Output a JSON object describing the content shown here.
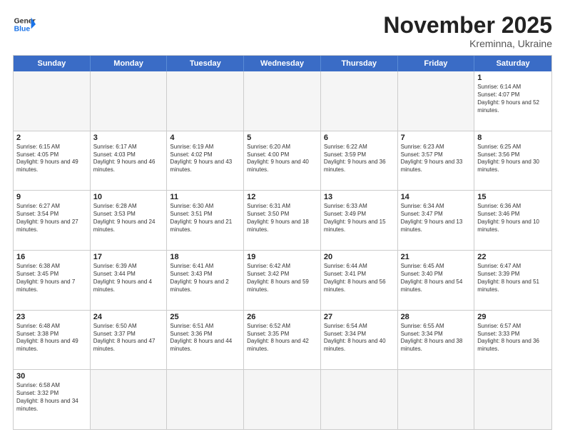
{
  "header": {
    "logo_general": "General",
    "logo_blue": "Blue",
    "month_title": "November 2025",
    "location": "Kreminna, Ukraine"
  },
  "day_headers": [
    "Sunday",
    "Monday",
    "Tuesday",
    "Wednesday",
    "Thursday",
    "Friday",
    "Saturday"
  ],
  "rows": [
    [
      {
        "date": "",
        "info": "",
        "empty": true
      },
      {
        "date": "",
        "info": "",
        "empty": true
      },
      {
        "date": "",
        "info": "",
        "empty": true
      },
      {
        "date": "",
        "info": "",
        "empty": true
      },
      {
        "date": "",
        "info": "",
        "empty": true
      },
      {
        "date": "",
        "info": "",
        "empty": true
      },
      {
        "date": "1",
        "info": "Sunrise: 6:14 AM\nSunset: 4:07 PM\nDaylight: 9 hours and 52 minutes.",
        "empty": false
      }
    ],
    [
      {
        "date": "2",
        "info": "Sunrise: 6:15 AM\nSunset: 4:05 PM\nDaylight: 9 hours and 49 minutes.",
        "empty": false
      },
      {
        "date": "3",
        "info": "Sunrise: 6:17 AM\nSunset: 4:03 PM\nDaylight: 9 hours and 46 minutes.",
        "empty": false
      },
      {
        "date": "4",
        "info": "Sunrise: 6:19 AM\nSunset: 4:02 PM\nDaylight: 9 hours and 43 minutes.",
        "empty": false
      },
      {
        "date": "5",
        "info": "Sunrise: 6:20 AM\nSunset: 4:00 PM\nDaylight: 9 hours and 40 minutes.",
        "empty": false
      },
      {
        "date": "6",
        "info": "Sunrise: 6:22 AM\nSunset: 3:59 PM\nDaylight: 9 hours and 36 minutes.",
        "empty": false
      },
      {
        "date": "7",
        "info": "Sunrise: 6:23 AM\nSunset: 3:57 PM\nDaylight: 9 hours and 33 minutes.",
        "empty": false
      },
      {
        "date": "8",
        "info": "Sunrise: 6:25 AM\nSunset: 3:56 PM\nDaylight: 9 hours and 30 minutes.",
        "empty": false
      }
    ],
    [
      {
        "date": "9",
        "info": "Sunrise: 6:27 AM\nSunset: 3:54 PM\nDaylight: 9 hours and 27 minutes.",
        "empty": false
      },
      {
        "date": "10",
        "info": "Sunrise: 6:28 AM\nSunset: 3:53 PM\nDaylight: 9 hours and 24 minutes.",
        "empty": false
      },
      {
        "date": "11",
        "info": "Sunrise: 6:30 AM\nSunset: 3:51 PM\nDaylight: 9 hours and 21 minutes.",
        "empty": false
      },
      {
        "date": "12",
        "info": "Sunrise: 6:31 AM\nSunset: 3:50 PM\nDaylight: 9 hours and 18 minutes.",
        "empty": false
      },
      {
        "date": "13",
        "info": "Sunrise: 6:33 AM\nSunset: 3:49 PM\nDaylight: 9 hours and 15 minutes.",
        "empty": false
      },
      {
        "date": "14",
        "info": "Sunrise: 6:34 AM\nSunset: 3:47 PM\nDaylight: 9 hours and 13 minutes.",
        "empty": false
      },
      {
        "date": "15",
        "info": "Sunrise: 6:36 AM\nSunset: 3:46 PM\nDaylight: 9 hours and 10 minutes.",
        "empty": false
      }
    ],
    [
      {
        "date": "16",
        "info": "Sunrise: 6:38 AM\nSunset: 3:45 PM\nDaylight: 9 hours and 7 minutes.",
        "empty": false
      },
      {
        "date": "17",
        "info": "Sunrise: 6:39 AM\nSunset: 3:44 PM\nDaylight: 9 hours and 4 minutes.",
        "empty": false
      },
      {
        "date": "18",
        "info": "Sunrise: 6:41 AM\nSunset: 3:43 PM\nDaylight: 9 hours and 2 minutes.",
        "empty": false
      },
      {
        "date": "19",
        "info": "Sunrise: 6:42 AM\nSunset: 3:42 PM\nDaylight: 8 hours and 59 minutes.",
        "empty": false
      },
      {
        "date": "20",
        "info": "Sunrise: 6:44 AM\nSunset: 3:41 PM\nDaylight: 8 hours and 56 minutes.",
        "empty": false
      },
      {
        "date": "21",
        "info": "Sunrise: 6:45 AM\nSunset: 3:40 PM\nDaylight: 8 hours and 54 minutes.",
        "empty": false
      },
      {
        "date": "22",
        "info": "Sunrise: 6:47 AM\nSunset: 3:39 PM\nDaylight: 8 hours and 51 minutes.",
        "empty": false
      }
    ],
    [
      {
        "date": "23",
        "info": "Sunrise: 6:48 AM\nSunset: 3:38 PM\nDaylight: 8 hours and 49 minutes.",
        "empty": false
      },
      {
        "date": "24",
        "info": "Sunrise: 6:50 AM\nSunset: 3:37 PM\nDaylight: 8 hours and 47 minutes.",
        "empty": false
      },
      {
        "date": "25",
        "info": "Sunrise: 6:51 AM\nSunset: 3:36 PM\nDaylight: 8 hours and 44 minutes.",
        "empty": false
      },
      {
        "date": "26",
        "info": "Sunrise: 6:52 AM\nSunset: 3:35 PM\nDaylight: 8 hours and 42 minutes.",
        "empty": false
      },
      {
        "date": "27",
        "info": "Sunrise: 6:54 AM\nSunset: 3:34 PM\nDaylight: 8 hours and 40 minutes.",
        "empty": false
      },
      {
        "date": "28",
        "info": "Sunrise: 6:55 AM\nSunset: 3:34 PM\nDaylight: 8 hours and 38 minutes.",
        "empty": false
      },
      {
        "date": "29",
        "info": "Sunrise: 6:57 AM\nSunset: 3:33 PM\nDaylight: 8 hours and 36 minutes.",
        "empty": false
      }
    ],
    [
      {
        "date": "30",
        "info": "Sunrise: 6:58 AM\nSunset: 3:32 PM\nDaylight: 8 hours and 34 minutes.",
        "empty": false
      },
      {
        "date": "",
        "info": "",
        "empty": true
      },
      {
        "date": "",
        "info": "",
        "empty": true
      },
      {
        "date": "",
        "info": "",
        "empty": true
      },
      {
        "date": "",
        "info": "",
        "empty": true
      },
      {
        "date": "",
        "info": "",
        "empty": true
      },
      {
        "date": "",
        "info": "",
        "empty": true
      }
    ]
  ]
}
